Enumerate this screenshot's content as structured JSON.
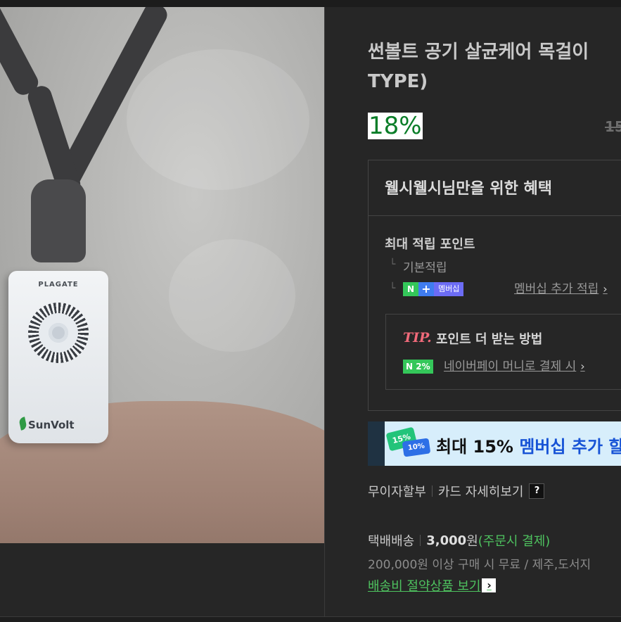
{
  "product": {
    "title_line1": "썬볼트 공기 살균케어 목걸이",
    "title_line2": "TYPE)",
    "discount": "18%",
    "original_price": "15",
    "photo": {
      "brand_top": "PLAGATE",
      "brand_bottom": "SunVolt"
    }
  },
  "benefits": {
    "heading": "웰시웰시님만을 위한 혜택",
    "max_points_label": "최대 적립 포인트",
    "basic_points_label": "기본적립",
    "membership_badge": "멤버십",
    "membership_link": "멤버십 추가 적립",
    "tip_label": "TIP.",
    "tip_title": "포인트 더 받는 방법",
    "npay_badge": "2%",
    "npay_link": "네이버페이 머니로 결제 시"
  },
  "banner": {
    "ticket1": "15%",
    "ticket2": "10%",
    "text_prefix": "최대 15% ",
    "text_highlight": "멤버십 추가 할"
  },
  "payment": {
    "installment": "무이자할부",
    "card_details": "카드 자세히보기",
    "help_badge": "?"
  },
  "shipping": {
    "method": "택배배송",
    "price": "3,000",
    "won": "원",
    "note": "(주문시 결제)",
    "free_condition": "200,000원 이상 구매 시 무료 / 제주,도서지",
    "save_link": "배송비 절약상품 보기"
  },
  "icons": {
    "chevron": "chevron-right-icon",
    "help": "question-icon"
  },
  "colors": {
    "discount_green": "#0a7d28",
    "link_green": "#4ec25f",
    "tip_pink": "#f06a7a",
    "banner_blue": "#1753d6"
  }
}
